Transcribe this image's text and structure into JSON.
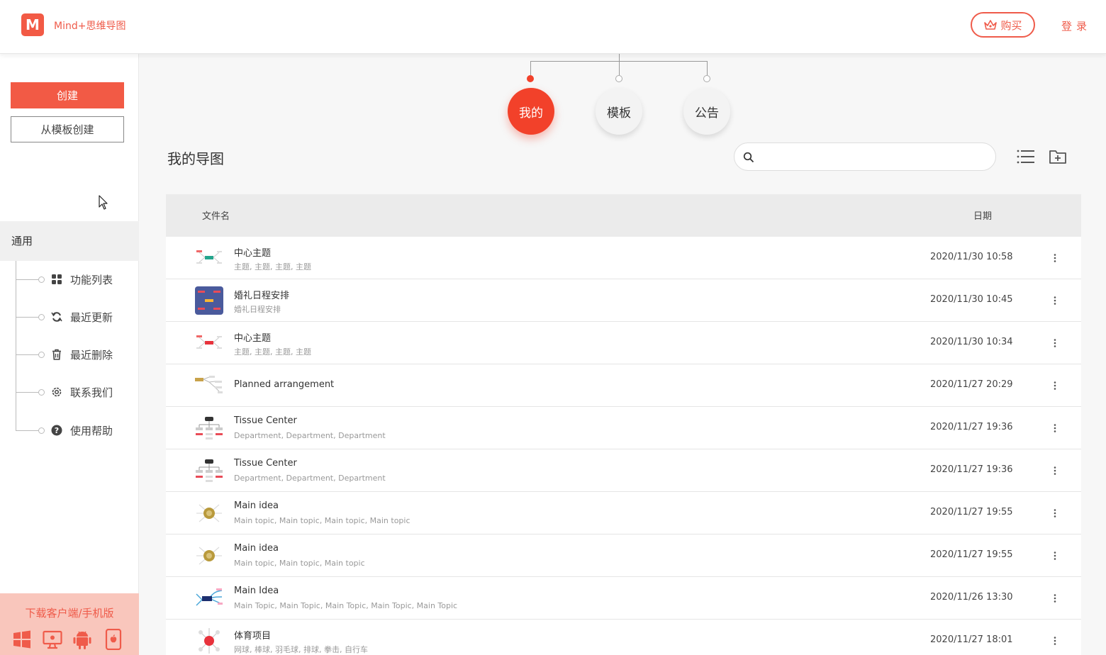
{
  "header": {
    "app_title": "Mind+思维导图",
    "logo_letter": "M",
    "buy_label": "购买",
    "login_label": "登录"
  },
  "colors": {
    "accent": "#f25a45",
    "accent_dark": "#f2412a",
    "download_bg": "#f9c6bc"
  },
  "sidebar": {
    "create_label": "创建",
    "from_template_label": "从模板创建",
    "section_label": "通用",
    "items": [
      {
        "label": "功能列表",
        "icon": "grid-icon"
      },
      {
        "label": "最近更新",
        "icon": "refresh-icon"
      },
      {
        "label": "最近删除",
        "icon": "trash-icon"
      },
      {
        "label": "联系我们",
        "icon": "gear-icon"
      },
      {
        "label": "使用帮助",
        "icon": "help-icon"
      }
    ],
    "download_label": "下载客户端/手机版",
    "download_icons": [
      "windows-icon",
      "desktop-icon",
      "android-icon",
      "ios-icon"
    ]
  },
  "tabs": [
    {
      "label": "我的",
      "active": true
    },
    {
      "label": "模板",
      "active": false
    },
    {
      "label": "公告",
      "active": false
    }
  ],
  "main": {
    "title": "我的导图",
    "search_placeholder": "",
    "columns": {
      "name": "文件名",
      "date": "日期"
    }
  },
  "files": [
    {
      "title": "中心主题",
      "subtitle": "主题, 主题, 主题, 主题",
      "date": "2020/11/30 10:58",
      "thumb": "mindmap-teal"
    },
    {
      "title": "婚礼日程安排",
      "subtitle": "婚礼日程安排",
      "date": "2020/11/30 10:45",
      "thumb": "wedding"
    },
    {
      "title": "中心主题",
      "subtitle": "主题, 主题, 主题, 主题",
      "date": "2020/11/30 10:34",
      "thumb": "mindmap-red"
    },
    {
      "title": "Planned arrangement",
      "subtitle": "",
      "date": "2020/11/27 20:29",
      "thumb": "plan"
    },
    {
      "title": "Tissue Center",
      "subtitle": "Department, Department, Department",
      "date": "2020/11/27 19:36",
      "thumb": "org"
    },
    {
      "title": "Tissue Center",
      "subtitle": "Department, Department, Department",
      "date": "2020/11/27 19:36",
      "thumb": "org"
    },
    {
      "title": "Main idea",
      "subtitle": "Main topic, Main topic, Main topic, Main topic",
      "date": "2020/11/27 19:55",
      "thumb": "radial"
    },
    {
      "title": "Main idea",
      "subtitle": "Main topic, Main topic, Main topic",
      "date": "2020/11/27 19:55",
      "thumb": "radial"
    },
    {
      "title": "Main Idea",
      "subtitle": "Main Topic, Main Topic, Main Topic, Main Topic, Main Topic",
      "date": "2020/11/26 13:30",
      "thumb": "navy"
    },
    {
      "title": "体育项目",
      "subtitle": "网球, 棒球, 羽毛球, 排球, 拳击, 自行车",
      "date": "2020/11/27 18:01",
      "thumb": "sport"
    }
  ]
}
